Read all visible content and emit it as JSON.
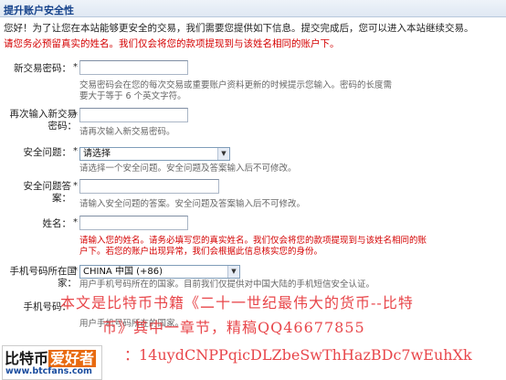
{
  "header": {
    "title": "提升账户安全性"
  },
  "intro_text": "您好！为了让您在本站能够更安全的交易，我们需要您提供如下信息。提交完成后，您可以进入本站继续交易。",
  "warning_text": "请您务必预留真实的姓名。我们仅会将您的款项提现到与该姓名相同的账户下。",
  "required_mark": "*",
  "fields": {
    "new_password": {
      "label": "新交易密码：",
      "hint_line1": "交易密码会在您的每次交易或重要账户资料更新的时候提示您输入。密码的长度需",
      "hint_line2": "要大于等于 6 个英文字符。"
    },
    "confirm_password": {
      "label_line1": "再次输入新交易",
      "label_line2": "密码：",
      "hint": "请再次输入新交易密码。"
    },
    "security_question": {
      "label": "安全问题：",
      "selected": "请选择",
      "hint": "请选择一个安全问题。安全问题及答案输入后不可修改。"
    },
    "security_answer": {
      "label_line1": "安全问题答",
      "label_line2": "案：",
      "hint": "请输入安全问题的答案。安全问题及答案输入后不可修改。"
    },
    "name": {
      "label": "姓名：",
      "hint_line1": "请输入您的姓名。请务必填写您的真实姓名。我们仅会将您的款项提现到与该姓名相同的账",
      "hint_line2": "户下。若您的账户出现异常，我们会根据此信息核实您的身份。"
    },
    "phone_country": {
      "label_line1": "手机号码所在国",
      "label_line2": "家：",
      "selected": "CHINA 中国 (+86)",
      "hint": "用户手机号码所在的国家。目前我们仅提供对中国大陆的手机短信安全认证。"
    },
    "phone_number": {
      "label": "手机号码：",
      "hint": "用户手机号码所在的国家。"
    }
  },
  "watermark": {
    "line1": "本文是比特币书籍《二十一世纪最伟大的货币--比特",
    "line2": "币》其中一章节，精稿QQ46677855",
    "line3": "：14uydCNPPqicDLZbeSwThHazBDc7wEuhXk"
  },
  "logo": {
    "part1": "比特币",
    "part2": "爱好者",
    "url": "www.btcfans.com"
  },
  "colors": {
    "header_text": "#15428b",
    "warning": "#d40000",
    "watermark": "#e8464a",
    "logo_orange": "#e86a10"
  }
}
